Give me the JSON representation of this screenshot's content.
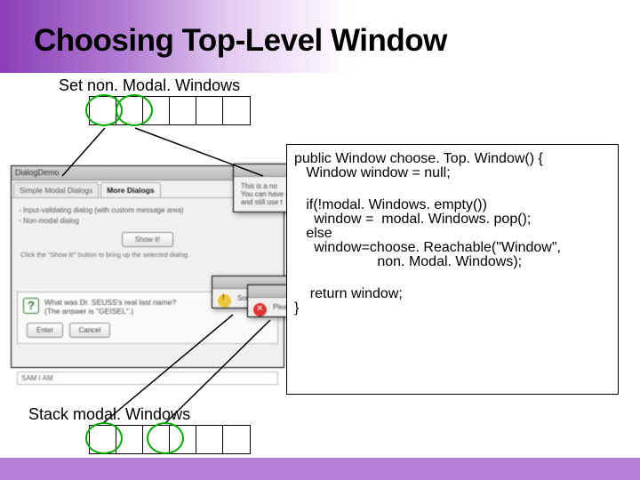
{
  "title": "Choosing Top-Level Window",
  "labels": {
    "nonModal": "Set non. Modal. Windows",
    "modalStack": "Stack modal. Windows"
  },
  "top_cells_count": 6,
  "bottom_cells_count": 6,
  "code": {
    "l1": "public Window choose. Top. Window() {",
    "l2": "   Window window = null;",
    "l3": "",
    "l4": "   if(!modal. Windows. empty())",
    "l5": "     window =  modal. Windows. pop();",
    "l6": "   else",
    "l7": "     window=choose. Reachable(\"Window\",",
    "l8": "                     non. Modal. Windows);",
    "l9": "",
    "l10": "    return window;",
    "l11": "}"
  },
  "dialogDemo": {
    "windowTitle": "DialogDemo",
    "tabs": [
      "Simple Modal Dialogs",
      "More Dialogs"
    ],
    "activeTab": 1,
    "radioOptions": [
      "Input-validating dialog (with custom message area)",
      "Non-modal dialog"
    ],
    "showButton": "Show it!",
    "hint": "Click the \"Show it!\" button to bring up the selected dialog.",
    "question": {
      "line1": "What was Dr. SEUSS's real last name?",
      "line2": "(The answer is \"GEISEL\".)",
      "buttons": [
        "Enter",
        "Cancel"
      ],
      "inputValue": "SAM I AM"
    }
  },
  "foregroundDialogs": {
    "topRight": {
      "line1": "This is a no",
      "line2": "You can have or",
      "line3": "and still use t"
    },
    "warning": {
      "text": "Sorry, \"SAM I"
    },
    "error": {
      "text": "Please enter d"
    }
  }
}
